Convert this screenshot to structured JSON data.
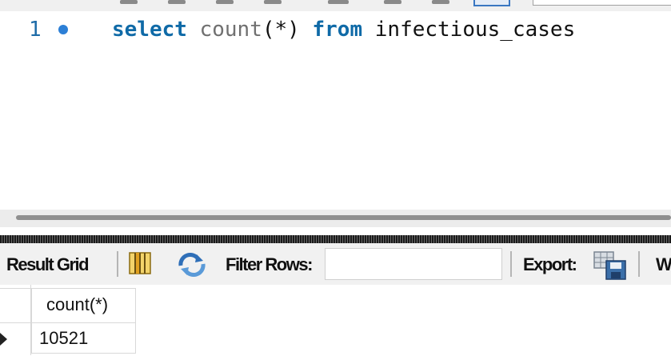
{
  "editor": {
    "line_number": "1",
    "code": {
      "keyword_select": "select",
      "function_name": "count",
      "args": "(*)",
      "keyword_from": "from",
      "table_name": "infectious_cases"
    }
  },
  "result_toolbar": {
    "result_grid_label": "Result Grid",
    "filter_rows_label": "Filter Rows:",
    "filter_value": "",
    "export_label": "Export:",
    "wrap_label_partial": "W"
  },
  "grid": {
    "columns": [
      "count(*)"
    ],
    "rows": [
      [
        "10521"
      ]
    ]
  },
  "icons": {
    "grid_toggle": "grid-columns-icon",
    "refresh": "refresh-icon",
    "export": "export-save-icon",
    "current_row": "row-pointer-icon",
    "breakpoint": "line-bullet-icon"
  },
  "colors": {
    "keyword": "#0f6aa7",
    "function": "#707070",
    "line_number": "#1e6ca8",
    "bullet": "#2c7fd6"
  }
}
